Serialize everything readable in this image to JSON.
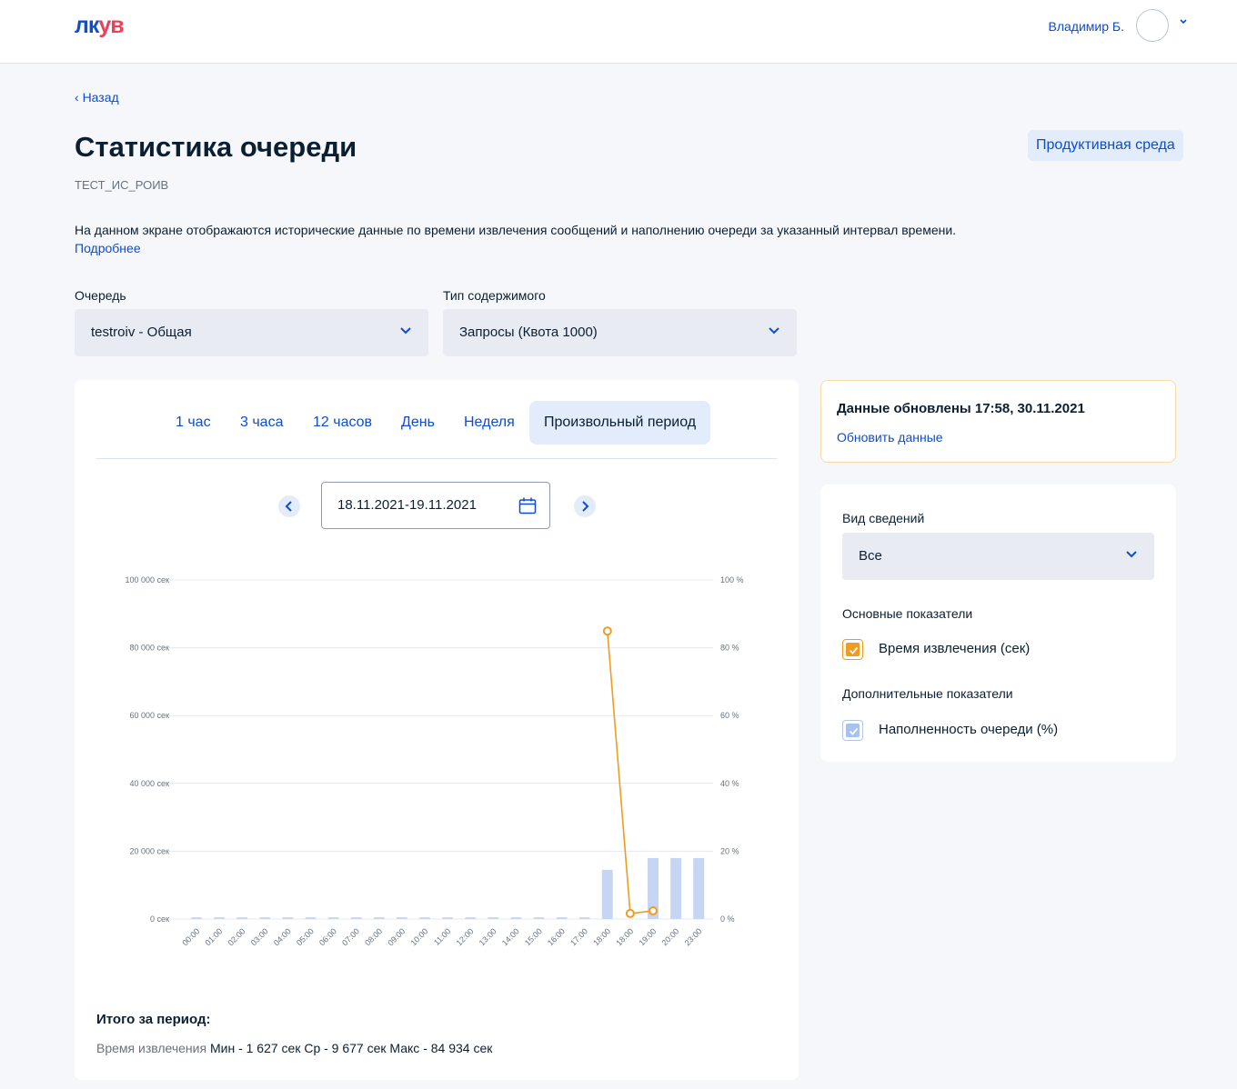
{
  "header": {
    "logo_part1": "лк",
    "logo_part2": "ув",
    "user_name": "Владимир Б."
  },
  "nav": {
    "back_label": "Назад"
  },
  "page": {
    "title": "Статистика очереди",
    "subtitle": "ТЕСТ_ИС_РОИВ",
    "environment_badge": "Продуктивная среда",
    "description": "На данном экране отображаются исторические данные по времени извлечения сообщений и наполнению очереди за указанный интервал времени.",
    "more_link": "Подробнее"
  },
  "filters": {
    "queue": {
      "label": "Очередь",
      "value": "testroiv - Общая"
    },
    "content_type": {
      "label": "Тип содержимого",
      "value": "Запросы (Квота 1000)"
    }
  },
  "period_tabs": [
    "1 час",
    "3 часа",
    "12 часов",
    "День",
    "Неделя",
    "Произвольный период"
  ],
  "active_period_tab": "Произвольный период",
  "date_range": "18.11.2021-19.11.2021",
  "update": {
    "title": "Данные обновлены 17:58, 30.11.2021",
    "refresh_link": "Обновить данные"
  },
  "view": {
    "label": "Вид сведений",
    "value": "Все",
    "main_section": "Основные показатели",
    "extra_section": "Дополнительные показатели",
    "main_metric": "Время извлечения (сек)",
    "extra_metric": "Наполненность очереди (%)"
  },
  "totals": {
    "title": "Итого за период:",
    "metric_label": "Время извлечения",
    "values": "Мин - 1 627 сек Ср - 9 677 сек Макс - 84 934 сек"
  },
  "colors": {
    "accent": "#0d4cd3",
    "line": "#f39b20",
    "bar": "#c5d6f5",
    "grid": "#e4e9f0"
  },
  "chart_data": {
    "type": "bar+line",
    "categories": [
      "00:00",
      "01:00",
      "02:00",
      "03:00",
      "04:00",
      "05:00",
      "06:00",
      "07:00",
      "08:00",
      "09:00",
      "10:00",
      "11:00",
      "12:00",
      "13:00",
      "14:00",
      "15:00",
      "16:00",
      "17:00",
      "18:00",
      "18:00",
      "19:00",
      "20:00",
      "23:00"
    ],
    "y_left": {
      "ticks": [
        "100 000 сек",
        "80 000 сек",
        "60 000 сек",
        "40 000 сек",
        "20 000 сек",
        "0 сек"
      ],
      "ylim": [
        0,
        100000
      ]
    },
    "y_right": {
      "ticks": [
        "100 %",
        "80 %",
        "60 %",
        "40 %",
        "20 %",
        "0 %"
      ],
      "ylim": [
        0,
        100
      ]
    },
    "series": [
      {
        "name": "Наполненность очереди (%)",
        "type": "bar",
        "axis": "right",
        "values": [
          0.5,
          0.5,
          0.5,
          0.5,
          0.5,
          0.5,
          0.5,
          0.5,
          0.5,
          0.5,
          0.5,
          0.5,
          0.5,
          0.5,
          0.5,
          0.5,
          0.5,
          0.5,
          14.5,
          0,
          18,
          18,
          18
        ]
      },
      {
        "name": "Время извлечения (сек)",
        "type": "line",
        "axis": "left",
        "points": [
          {
            "index": 18,
            "value": 84934
          },
          {
            "index": 19,
            "value": 1627
          },
          {
            "index": 20,
            "value": 2400
          }
        ]
      }
    ],
    "grid": true,
    "legend": "none"
  }
}
